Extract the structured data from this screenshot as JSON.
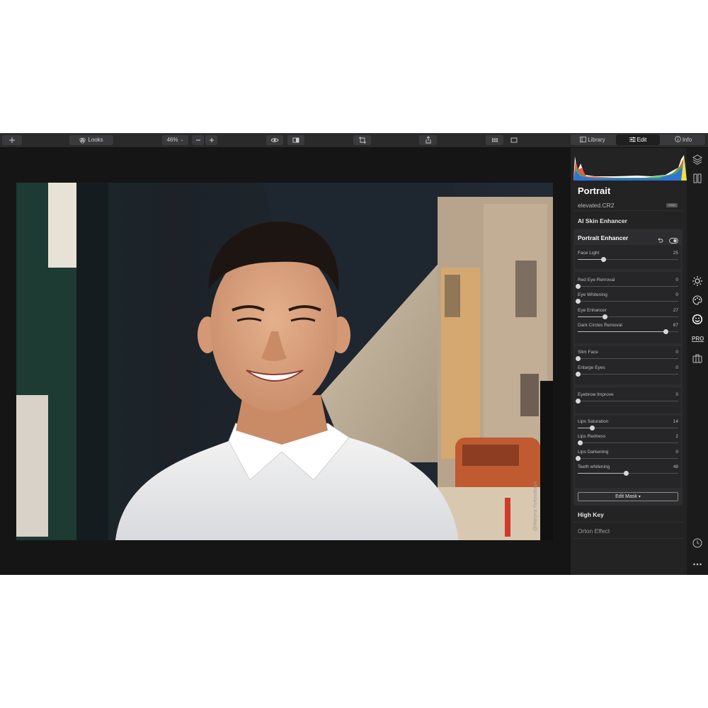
{
  "toolbar": {
    "looks_label": "Looks",
    "zoom_value": "46%",
    "tabs": [
      {
        "label": "Library"
      },
      {
        "label": "Edit"
      },
      {
        "label": "Info"
      }
    ]
  },
  "photo": {
    "watermark": "@Maryna Yurlovskaya"
  },
  "panel": {
    "title": "Portrait",
    "filename": "elevated.CR2",
    "badge": "RAW",
    "section_ai_skin": "AI Skin Enhancer",
    "card_title": "Portrait Enhancer",
    "sliders": [
      {
        "name": "Face Light",
        "value": 25
      },
      {
        "name": "Red Eye Removal",
        "value": 0
      },
      {
        "name": "Eye Whitening",
        "value": 0
      },
      {
        "name": "Eye Enhancer",
        "value": 27
      },
      {
        "name": "Dark Circles Removal",
        "value": 87
      },
      {
        "name": "Slim Face",
        "value": 0
      },
      {
        "name": "Enlarge Eyes",
        "value": 0
      },
      {
        "name": "Eyebrow Improve",
        "value": 0
      },
      {
        "name": "Lips Saturation",
        "value": 14
      },
      {
        "name": "Lips Redness",
        "value": 2
      },
      {
        "name": "Lips Darkening",
        "value": 0
      },
      {
        "name": "Teeth whitening",
        "value": 48
      }
    ],
    "edit_mask_label": "Edit Mask",
    "section_high_key": "High Key",
    "section_orton": "Orton Effect"
  },
  "rail": {
    "pro_label": "PRO"
  },
  "colors": {
    "app_bg": "#1b1b1c",
    "toolbar_bg": "#2a2a2b",
    "panel_bg": "#232324",
    "card_bg": "#2d2d2f"
  },
  "icons": [
    "plus-icon",
    "looks-icon",
    "minus-icon",
    "plus-icon",
    "eye-icon",
    "compare-icon",
    "crop-icon",
    "share-icon",
    "grid-icon",
    "single-view-icon",
    "library-icon",
    "edit-sliders-icon",
    "info-icon",
    "layers-icon",
    "compare-panel-icon",
    "sun-icon",
    "palette-icon",
    "face-icon",
    "pro-icon",
    "bag-icon",
    "history-icon",
    "more-icon",
    "undo-icon",
    "toggle-visibility-icon"
  ]
}
